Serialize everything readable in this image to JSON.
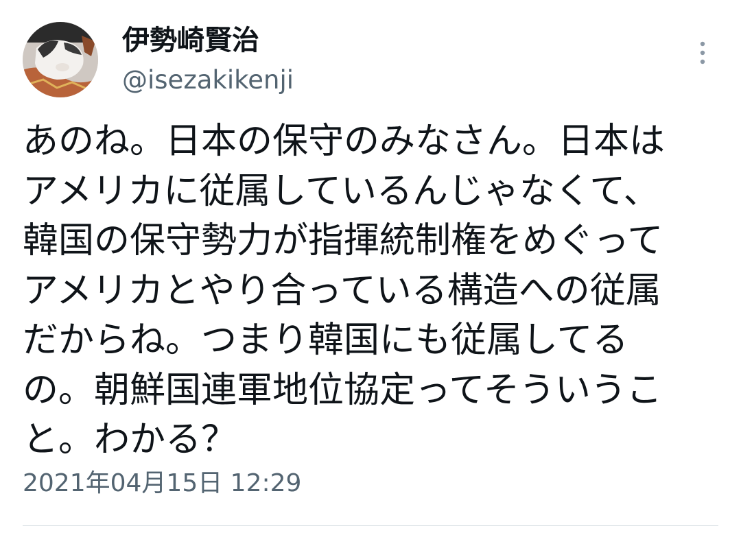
{
  "tweet": {
    "author": {
      "display_name": "伊勢崎賢治",
      "handle": "@isezakikenji",
      "avatar_icon": "cat-photo-avatar"
    },
    "more_icon": "more-vertical-icon",
    "text": "あのね。日本の保守のみなさん。日本は\nアメリカに従属しているんじゃなくて、\n韓国の保守勢力が指揮統制権をめぐって\nアメリカとやり合っている構造への従属\nだからね。つまり韓国にも従属してる\nの。朝鮮国連軍地位協定ってそういうこ\nと。わかる？",
    "timestamp": "2021年04月15日 12:29"
  },
  "colors": {
    "text_primary": "#0f1419",
    "text_secondary": "#536471",
    "divider": "#cfd9de"
  }
}
